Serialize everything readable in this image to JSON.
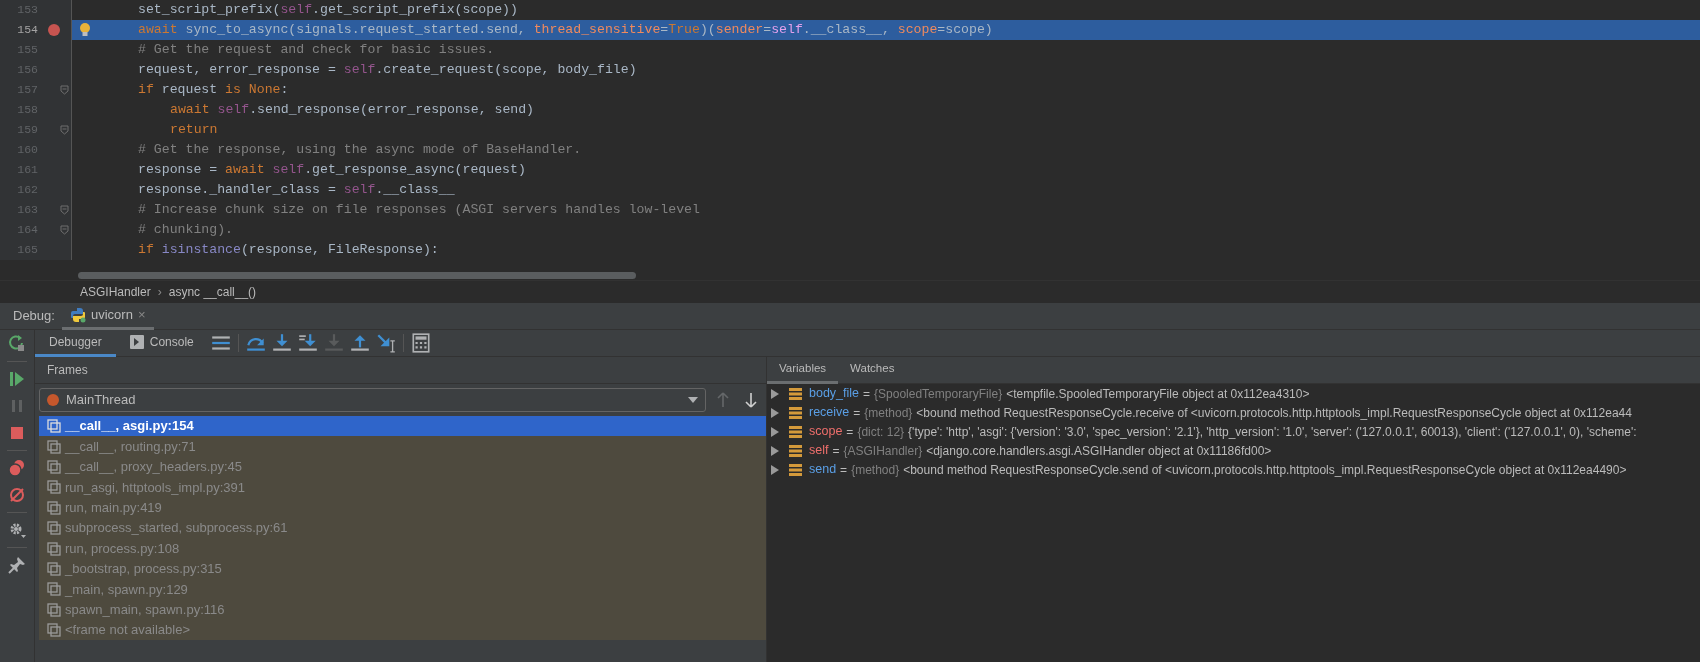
{
  "editor": {
    "lines": [
      {
        "number": "153",
        "selected": false,
        "breakpoint": false,
        "bulb": false,
        "fold": false,
        "indented": false,
        "tokens": [
          {
            "kind": "plain",
            "text": "set_script_prefix("
          },
          {
            "kind": "self",
            "text": "self"
          },
          {
            "kind": "plain",
            "text": ".get_script_prefix(scope))"
          }
        ]
      },
      {
        "number": "154",
        "selected": true,
        "breakpoint": true,
        "bulb": true,
        "fold": false,
        "indented": false,
        "tokens": [
          {
            "kind": "keyword",
            "text": "await "
          },
          {
            "kind": "plain",
            "text": "sync_to_async(signals.request_started.send, "
          },
          {
            "kind": "param",
            "text": "thread_sensitive"
          },
          {
            "kind": "plain",
            "text": "="
          },
          {
            "kind": "keyword",
            "text": "True"
          },
          {
            "kind": "plain",
            "text": ")("
          },
          {
            "kind": "param",
            "text": "sender"
          },
          {
            "kind": "plain",
            "text": "="
          },
          {
            "kind": "self",
            "text": "self"
          },
          {
            "kind": "plain",
            "text": ".__class__, "
          },
          {
            "kind": "param",
            "text": "scope"
          },
          {
            "kind": "plain",
            "text": "=scope)"
          }
        ]
      },
      {
        "number": "155",
        "selected": false,
        "breakpoint": false,
        "bulb": false,
        "fold": false,
        "indented": false,
        "tokens": [
          {
            "kind": "comment",
            "text": "# Get the request and check for basic issues."
          }
        ]
      },
      {
        "number": "156",
        "selected": false,
        "breakpoint": false,
        "bulb": false,
        "fold": false,
        "indented": false,
        "tokens": [
          {
            "kind": "plain",
            "text": "request, error_response = "
          },
          {
            "kind": "self",
            "text": "self"
          },
          {
            "kind": "plain",
            "text": ".create_request(scope, body_file)"
          }
        ]
      },
      {
        "number": "157",
        "selected": false,
        "breakpoint": false,
        "bulb": false,
        "fold": true,
        "indented": false,
        "tokens": [
          {
            "kind": "keyword",
            "text": "if "
          },
          {
            "kind": "plain",
            "text": "request "
          },
          {
            "kind": "keyword",
            "text": "is None"
          },
          {
            "kind": "plain",
            "text": ":"
          }
        ]
      },
      {
        "number": "158",
        "selected": false,
        "breakpoint": false,
        "bulb": false,
        "fold": false,
        "indented": true,
        "tokens": [
          {
            "kind": "keyword",
            "text": "await "
          },
          {
            "kind": "self",
            "text": "self"
          },
          {
            "kind": "plain",
            "text": ".send_response(error_response, send)"
          }
        ]
      },
      {
        "number": "159",
        "selected": false,
        "breakpoint": false,
        "bulb": false,
        "fold": true,
        "indented": true,
        "tokens": [
          {
            "kind": "keyword",
            "text": "return"
          }
        ]
      },
      {
        "number": "160",
        "selected": false,
        "breakpoint": false,
        "bulb": false,
        "fold": false,
        "indented": false,
        "tokens": [
          {
            "kind": "comment",
            "text": "# Get the response, using the async mode of BaseHandler."
          }
        ]
      },
      {
        "number": "161",
        "selected": false,
        "breakpoint": false,
        "bulb": false,
        "fold": false,
        "indented": false,
        "tokens": [
          {
            "kind": "plain",
            "text": "response = "
          },
          {
            "kind": "keyword",
            "text": "await "
          },
          {
            "kind": "self",
            "text": "self"
          },
          {
            "kind": "plain",
            "text": ".get_response_async(request)"
          }
        ]
      },
      {
        "number": "162",
        "selected": false,
        "breakpoint": false,
        "bulb": false,
        "fold": false,
        "indented": false,
        "tokens": [
          {
            "kind": "plain",
            "text": "response._handler_class = "
          },
          {
            "kind": "self",
            "text": "self"
          },
          {
            "kind": "plain",
            "text": ".__class__"
          }
        ]
      },
      {
        "number": "163",
        "selected": false,
        "breakpoint": false,
        "bulb": false,
        "fold": true,
        "indented": false,
        "tokens": [
          {
            "kind": "comment",
            "text": "# Increase chunk size on file responses (ASGI servers handles low-level"
          }
        ]
      },
      {
        "number": "164",
        "selected": false,
        "breakpoint": false,
        "bulb": false,
        "fold": true,
        "indented": false,
        "tokens": [
          {
            "kind": "comment",
            "text": "# chunking)."
          }
        ]
      },
      {
        "number": "165",
        "selected": false,
        "breakpoint": false,
        "bulb": false,
        "fold": false,
        "indented": false,
        "tokens": [
          {
            "kind": "keyword",
            "text": "if "
          },
          {
            "kind": "builtin",
            "text": "isinstance"
          },
          {
            "kind": "plain",
            "text": "(response, FileResponse):"
          }
        ]
      }
    ],
    "breadcrumbs": [
      "ASGIHandler",
      "›",
      "async __call__()"
    ]
  },
  "debug": {
    "label": "Debug:",
    "session_tab": {
      "title": "uvicorn",
      "close": "×"
    },
    "side_buttons": [
      {
        "kind": "rerun",
        "disabled": false
      },
      {
        "kind": "resume",
        "disabled": false
      },
      {
        "kind": "pause",
        "disabled": true
      },
      {
        "kind": "stop",
        "disabled": false
      },
      {
        "kind": "breakpoints",
        "disabled": false
      },
      {
        "kind": "mute",
        "disabled": false
      },
      {
        "kind": "settings",
        "disabled": false
      },
      {
        "kind": "pin",
        "disabled": false
      }
    ],
    "tabs": [
      {
        "label": "Debugger",
        "selected": true
      },
      {
        "label": "Console",
        "selected": false
      }
    ],
    "step_buttons": [
      {
        "kind": "layout",
        "disabled": false
      },
      {
        "kind": "step-over",
        "disabled": false
      },
      {
        "kind": "step-into",
        "disabled": false
      },
      {
        "kind": "step-my-code",
        "disabled": false
      },
      {
        "kind": "force-step",
        "disabled": true
      },
      {
        "kind": "step-out",
        "disabled": false
      },
      {
        "kind": "run-cursor",
        "disabled": false
      },
      {
        "kind": "evaluate",
        "disabled": false
      }
    ],
    "frames": {
      "title": "Frames",
      "thread": {
        "name": "MainThread",
        "color": "#c5572c"
      },
      "up_disabled": true,
      "items": [
        {
          "label": "__call__, asgi.py:154",
          "selected": true
        },
        {
          "label": "__call__, routing.py:71",
          "selected": false
        },
        {
          "label": "__call__, proxy_headers.py:45",
          "selected": false
        },
        {
          "label": "run_asgi, httptools_impl.py:391",
          "selected": false
        },
        {
          "label": "run, main.py:419",
          "selected": false
        },
        {
          "label": "subprocess_started, subprocess.py:61",
          "selected": false
        },
        {
          "label": "run, process.py:108",
          "selected": false
        },
        {
          "label": "_bootstrap, process.py:315",
          "selected": false
        },
        {
          "label": "_main, spawn.py:129",
          "selected": false
        },
        {
          "label": "spawn_main, spawn.py:116",
          "selected": false
        },
        {
          "label": "<frame not available>",
          "selected": false
        }
      ]
    },
    "variables": {
      "tabs": [
        {
          "label": "Variables",
          "selected": true
        },
        {
          "label": "Watches",
          "selected": false
        }
      ],
      "items": [
        {
          "name": "body_file",
          "color": "#5a9fe6",
          "sep": "=",
          "type": "{SpooledTemporaryFile}",
          "value": "<tempfile.SpooledTemporaryFile object at 0x112ea4310>"
        },
        {
          "name": "receive",
          "color": "#5a9fe6",
          "sep": "=",
          "type": "{method}",
          "value": "<bound method RequestResponseCycle.receive of <uvicorn.protocols.http.httptools_impl.RequestResponseCycle object at 0x112ea44"
        },
        {
          "name": "scope",
          "color": "#ef6f6c",
          "sep": "=",
          "type": "{dict: 12}",
          "value": "{'type': 'http', 'asgi': {'version': '3.0', 'spec_version': '2.1'}, 'http_version': '1.0', 'server': ('127.0.0.1', 60013), 'client': ('127.0.0.1', 0), 'scheme':"
        },
        {
          "name": "self",
          "color": "#ef6f6c",
          "sep": "=",
          "type": "{ASGIHandler}",
          "value": "<django.core.handlers.asgi.ASGIHandler object at 0x11186fd00>"
        },
        {
          "name": "send",
          "color": "#5a9fe6",
          "sep": "=",
          "type": "{method}",
          "value": "<bound method RequestResponseCycle.send of <uvicorn.protocols.http.httptools_impl.RequestResponseCycle object at 0x112ea4490>"
        }
      ]
    }
  }
}
